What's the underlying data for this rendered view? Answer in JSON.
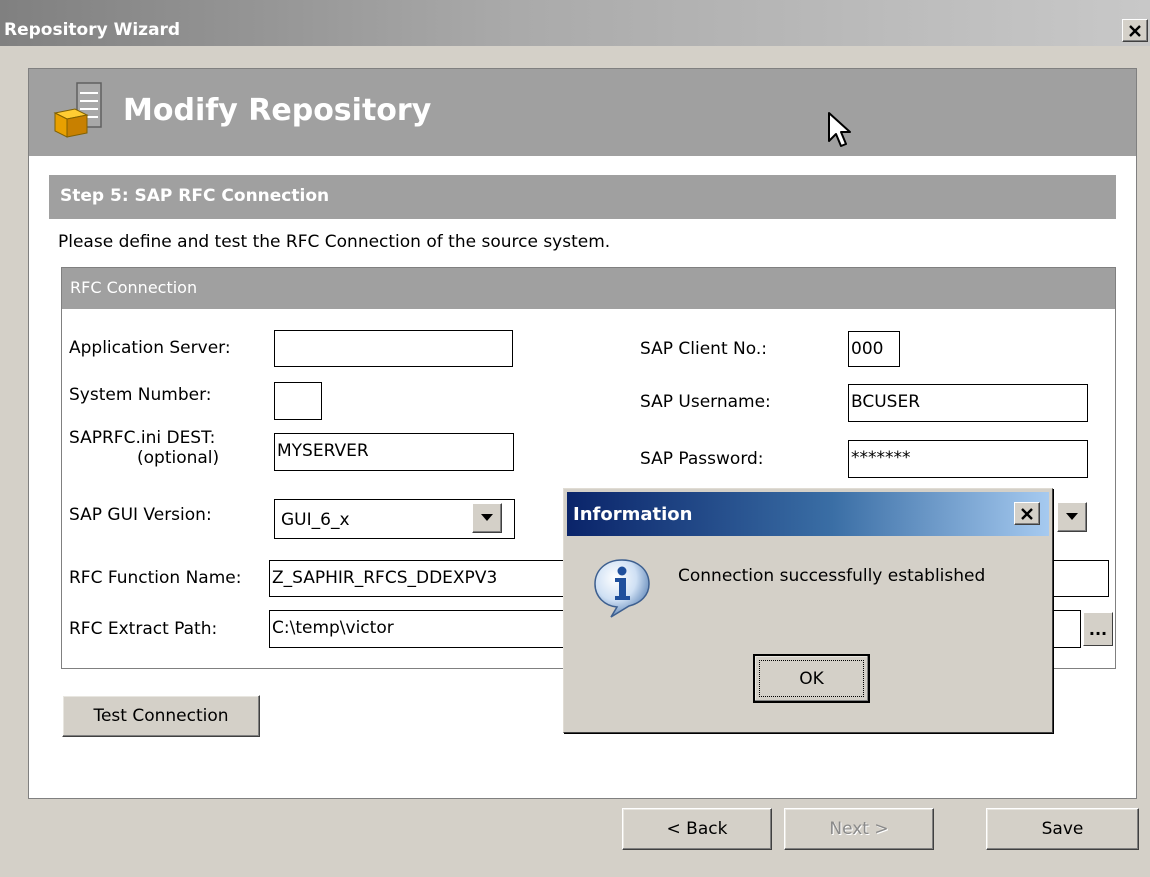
{
  "window": {
    "title": "Repository Wizard"
  },
  "header": {
    "title": "Modify Repository"
  },
  "step": {
    "title": "Step 5:  SAP RFC Connection"
  },
  "description": "Please define and test the RFC Connection of the source system.",
  "group": {
    "title": "RFC Connection",
    "application_server": {
      "label": "Application Server:",
      "value": ""
    },
    "system_number": {
      "label": "System Number:",
      "value": ""
    },
    "saprfc_dest": {
      "label": "SAPRFC.ini DEST:",
      "sublabel": "(optional)",
      "value": "MYSERVER"
    },
    "gui_version": {
      "label": "SAP GUI Version:",
      "value": "GUI_6_x"
    },
    "rfc_function": {
      "label": "RFC Function Name:",
      "value": "Z_SAPHIR_RFCS_DDEXPV3"
    },
    "rfc_extract_path": {
      "label": "RFC Extract Path:",
      "value": "C:\\temp\\victor",
      "browse_label": "..."
    },
    "client_no": {
      "label": "SAP Client No.:",
      "value": "000"
    },
    "username": {
      "label": "SAP Username:",
      "value": "BCUSER"
    },
    "password": {
      "label": "SAP Password:",
      "value": "*******"
    }
  },
  "buttons": {
    "test_connection": "Test Connection",
    "back": "< Back",
    "next": "Next >",
    "save": "Save"
  },
  "dialog": {
    "title": "Information",
    "message": "Connection successfully established",
    "ok": "OK"
  },
  "icons": {
    "repository": "database-box-icon",
    "info": "info-icon",
    "close": "close-icon",
    "dropdown": "chevron-down-icon",
    "cursor": "mouse-cursor-icon"
  },
  "colors": {
    "window_bg": "#d4d0c8",
    "header_bg": "#a0a0a0",
    "dialog_title_start": "#0a246a",
    "dialog_title_end": "#a6caf0"
  }
}
